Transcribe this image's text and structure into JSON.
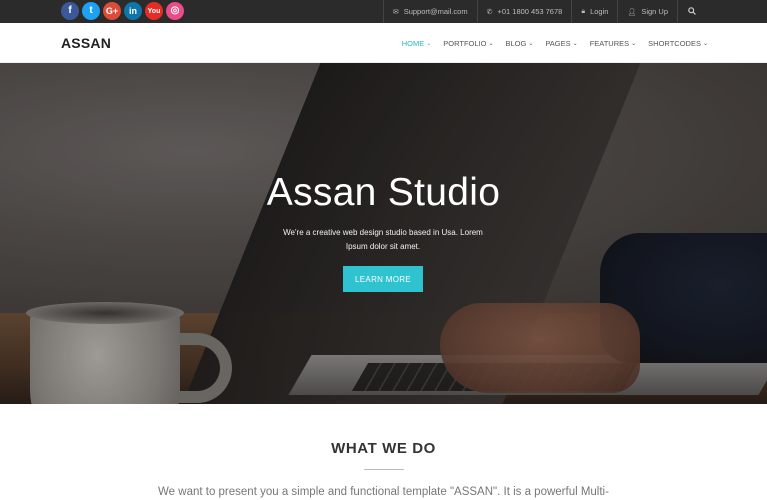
{
  "topbar": {
    "social": [
      {
        "icon": "facebook-icon",
        "glyph": "f"
      },
      {
        "icon": "twitter-icon",
        "glyph": "t"
      },
      {
        "icon": "google-plus-icon",
        "glyph": "G+"
      },
      {
        "icon": "linkedin-icon",
        "glyph": "in"
      },
      {
        "icon": "youtube-icon",
        "glyph": "You"
      },
      {
        "icon": "dribbble-icon",
        "glyph": "◎"
      }
    ],
    "email": "Support@mail.com",
    "phone": "+01 1800 453 7678",
    "login": "Login",
    "signup": "Sign Up"
  },
  "nav": {
    "logo": "ASSAN",
    "items": [
      {
        "label": "HOME",
        "active": true
      },
      {
        "label": "PORTFOLIO",
        "active": false
      },
      {
        "label": "BLOG",
        "active": false
      },
      {
        "label": "PAGES",
        "active": false
      },
      {
        "label": "FEATURES",
        "active": false
      },
      {
        "label": "SHORTCODES",
        "active": false
      }
    ]
  },
  "hero": {
    "title": "Assan Studio",
    "subtitle": "We're a creative web design studio based in Usa. Lorem Ipsum dolor sit amet.",
    "button": "LEARN MORE"
  },
  "section": {
    "title": "WHAT WE DO",
    "text": "We want to present you a simple and functional template \"ASSAN\". It is a powerful Multi-"
  },
  "colors": {
    "accent": "#2fc2cf",
    "topbar_bg": "#2b2b2b"
  }
}
